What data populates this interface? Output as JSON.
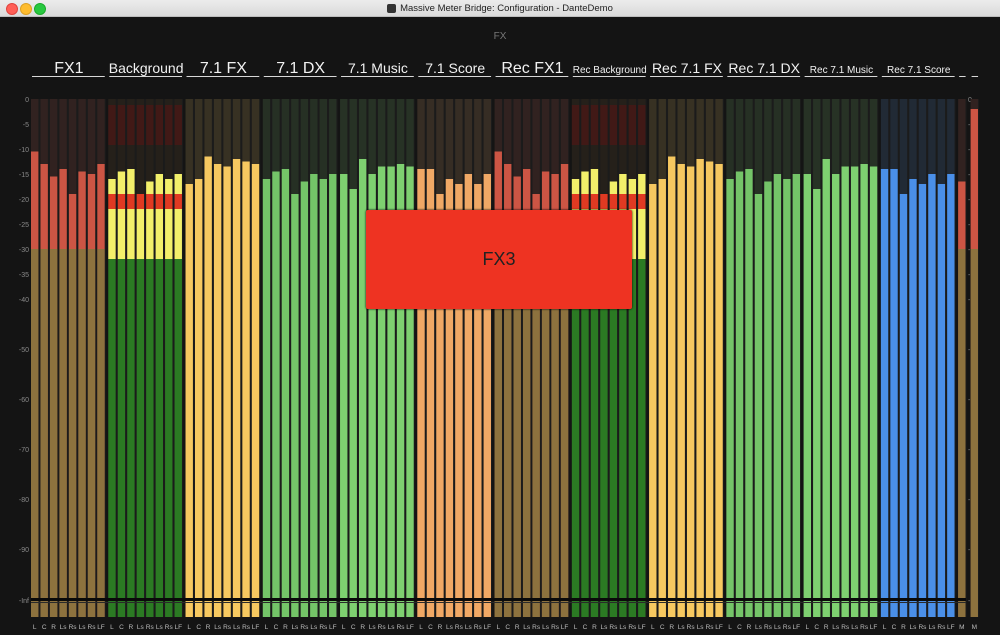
{
  "window": {
    "title": "Massive Meter Bridge: Configuration - DanteDemo"
  },
  "bridge": {
    "name": "FX"
  },
  "colors": {
    "red": "#cc5544",
    "yellow": "#f6c860",
    "orange": "#f0a865",
    "green": "#74c468",
    "green_bright": "#7ed070",
    "blue": "#4a8fe8",
    "bg_green": "#2b7a23",
    "block_red": "#ee3322"
  },
  "scale": {
    "ticks": [
      "0",
      "-5",
      "-10",
      "-15",
      "-20",
      "-25",
      "-30",
      "-35",
      "-40",
      "-50",
      "-60",
      "-70",
      "-80",
      "-90",
      "-Inf"
    ]
  },
  "groups": [
    {
      "name": "FX1",
      "color": "red",
      "channels": [
        "L",
        "C",
        "R",
        "Ls",
        "Rs",
        "Ls",
        "Rs",
        "LF"
      ],
      "levels": [
        -10.5,
        -13,
        -15.5,
        -14,
        -19,
        -14.5,
        -15,
        -13
      ]
    },
    {
      "name": "Background",
      "color": "background",
      "channels": [
        "L",
        "C",
        "R",
        "Ls",
        "Rs",
        "Ls",
        "Rs",
        "LF"
      ],
      "levels": [
        -16,
        -14.5,
        -14,
        -19,
        -16.5,
        -15,
        -16,
        -15
      ]
    },
    {
      "name": "7.1 FX",
      "color": "yellow",
      "channels": [
        "L",
        "C",
        "R",
        "Ls",
        "Rs",
        "Ls",
        "Rs",
        "LF"
      ],
      "levels": [
        -17,
        -16,
        -11.5,
        -13,
        -13.5,
        -12,
        -12.5,
        -13
      ]
    },
    {
      "name": "7.1 DX",
      "color": "green",
      "channels": [
        "L",
        "C",
        "R",
        "Ls",
        "Rs",
        "Ls",
        "Rs",
        "LF"
      ],
      "levels": [
        -16,
        -14.5,
        -14,
        -19,
        -16.5,
        -15,
        -16,
        -15
      ]
    },
    {
      "name": "7.1 Music",
      "color": "green_bright",
      "channels": [
        "L",
        "C",
        "R",
        "Ls",
        "Rs",
        "Ls",
        "Rs",
        "LF"
      ],
      "levels": [
        -15,
        -18,
        -12,
        -15,
        -13.5,
        -13.5,
        -13,
        -13.5
      ]
    },
    {
      "name": "7.1 Score",
      "color": "orange",
      "channels": [
        "L",
        "C",
        "R",
        "Ls",
        "Rs",
        "Ls",
        "Rs",
        "LF"
      ],
      "levels": [
        -14,
        -14,
        -19,
        -16,
        -17,
        -15,
        -17,
        -15
      ]
    },
    {
      "name": "Rec FX1",
      "color": "red",
      "channels": [
        "L",
        "C",
        "R",
        "Ls",
        "Rs",
        "Ls",
        "Rs",
        "LF"
      ],
      "levels": [
        -10.5,
        -13,
        -15.5,
        -14,
        -19,
        -14.5,
        -15,
        -13
      ]
    },
    {
      "name": "Rec Background",
      "color": "background",
      "channels": [
        "L",
        "C",
        "R",
        "Ls",
        "Rs",
        "Ls",
        "Rs",
        "LF"
      ],
      "levels": [
        -16,
        -14.5,
        -14,
        -19,
        -16.5,
        -15,
        -16,
        -15
      ]
    },
    {
      "name": "Rec 7.1 FX",
      "color": "yellow",
      "channels": [
        "L",
        "C",
        "R",
        "Ls",
        "Rs",
        "Ls",
        "Rs",
        "LF"
      ],
      "levels": [
        -17,
        -16,
        -11.5,
        -13,
        -13.5,
        -12,
        -12.5,
        -13
      ]
    },
    {
      "name": "Rec 7.1 DX",
      "color": "green",
      "channels": [
        "L",
        "C",
        "R",
        "Ls",
        "Rs",
        "Ls",
        "Rs",
        "LF"
      ],
      "levels": [
        -16,
        -14.5,
        -14,
        -19,
        -16.5,
        -15,
        -16,
        -15
      ]
    },
    {
      "name": "Rec 7.1 Music",
      "color": "green_bright",
      "channels": [
        "L",
        "C",
        "R",
        "Ls",
        "Rs",
        "Ls",
        "Rs",
        "LF"
      ],
      "levels": [
        -15,
        -18,
        -12,
        -15,
        -13.5,
        -13.5,
        -13,
        -13.5
      ]
    },
    {
      "name": "Rec 7.1 Score",
      "color": "blue",
      "channels": [
        "L",
        "C",
        "R",
        "Ls",
        "Rs",
        "Ls",
        "Rs",
        "LF"
      ],
      "levels": [
        -14,
        -14,
        -19,
        -16,
        -17,
        -15,
        -17,
        -15
      ]
    },
    {
      "name": "",
      "color": "red",
      "channels": [
        "M"
      ],
      "levels": [
        -16.5
      ]
    },
    {
      "name": "",
      "color": "red",
      "channels": [
        "M"
      ],
      "levels": [
        -2
      ]
    }
  ],
  "overlay": {
    "label": "FX3"
  }
}
